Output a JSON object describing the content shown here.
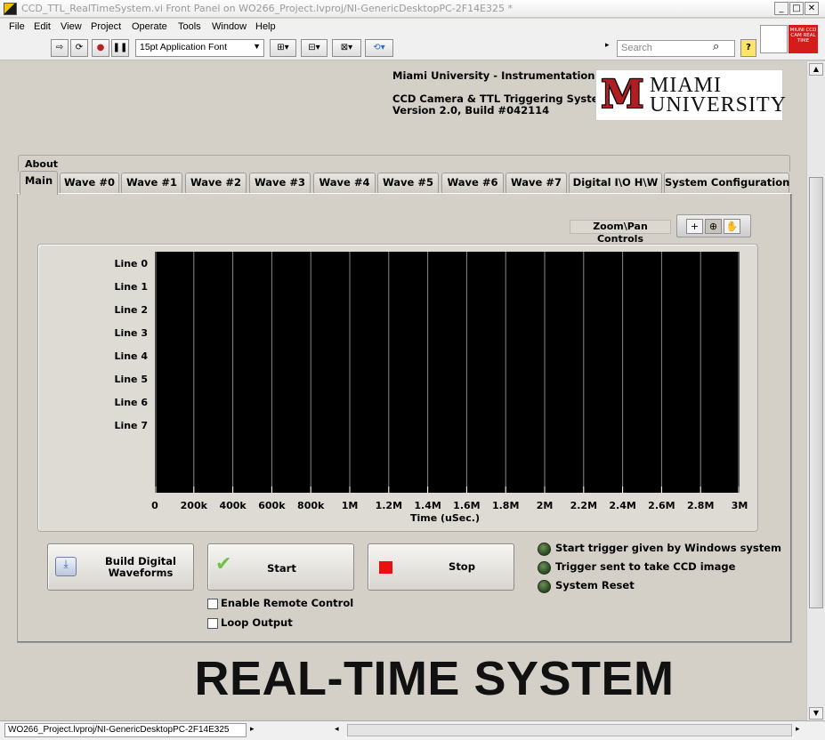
{
  "window": {
    "title": "CCD_TTL_RealTimeSystem.vi Front Panel on WO266_Project.lvproj/NI-GenericDesktopPC-2F14E325 *"
  },
  "menu": [
    "File",
    "Edit",
    "View",
    "Project",
    "Operate",
    "Tools",
    "Window",
    "Help"
  ],
  "toolbar": {
    "font_select": "15pt Application Font",
    "search_placeholder": "Search"
  },
  "vi_icon": {
    "text": "MIUNI CCD CAM REAL TIME",
    "color": "#d61b1b"
  },
  "header": {
    "lab": "Miami University - Instrumentation Lab",
    "system": "CCD Camera & TTL Triggering System",
    "version": "Version 2.0, Build #042114"
  },
  "logo": {
    "line1": "MIAMI",
    "line2": "UNIVERSITY",
    "letter": "M",
    "color": "#b01e24"
  },
  "tabs": {
    "about": "About",
    "items": [
      "Main",
      "Wave #0",
      "Wave #1",
      "Wave #2",
      "Wave #3",
      "Wave #4",
      "Wave #5",
      "Wave #6",
      "Wave #7",
      "Digital I\\O H\\W",
      "System Configuration"
    ],
    "active": "Main"
  },
  "zoom": {
    "label": "Zoom\\Pan Controls"
  },
  "graph": {
    "lines": [
      "Line 0",
      "Line 1",
      "Line 2",
      "Line 3",
      "Line 4",
      "Line 5",
      "Line 6",
      "Line 7"
    ],
    "x_ticks": [
      "0",
      "200k",
      "400k",
      "600k",
      "800k",
      "1M",
      "1.2M",
      "1.4M",
      "1.6M",
      "1.8M",
      "2M",
      "2.2M",
      "2.4M",
      "2.6M",
      "2.8M",
      "3M"
    ],
    "x_label": "Time (uSec.)"
  },
  "buttons": {
    "build_line1": "Build Digital",
    "build_line2": "Waveforms",
    "start": "Start",
    "stop": "Stop"
  },
  "checkboxes": {
    "remote": "Enable Remote Control",
    "loop": "Loop Output"
  },
  "indicators": [
    "Start trigger given by Windows system",
    "Trigger sent to take CCD image",
    "System Reset"
  ],
  "banner": "REAL-TIME SYSTEM",
  "statusbar": {
    "path": "WO266_Project.lvproj/NI-GenericDesktopPC-2F14E325"
  }
}
